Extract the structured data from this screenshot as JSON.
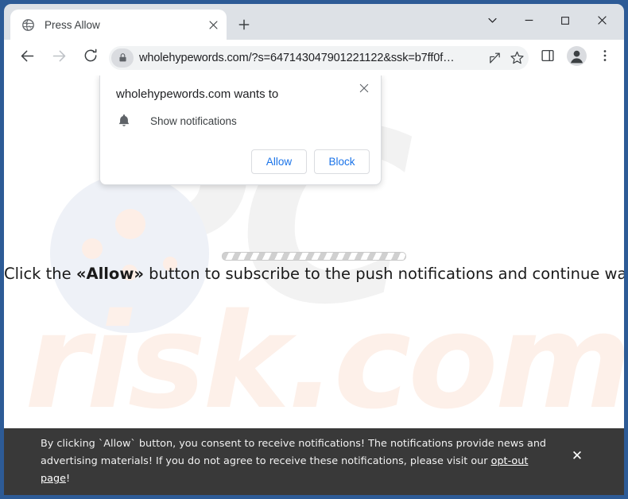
{
  "window": {
    "frame_color": "#2d5b96",
    "controls": [
      {
        "name": "tab-search",
        "icon": "chevron-down-icon"
      },
      {
        "name": "minimize",
        "icon": "minimize-icon"
      },
      {
        "name": "maximize",
        "icon": "maximize-icon"
      },
      {
        "name": "close",
        "icon": "close-icon"
      }
    ]
  },
  "tabstrip": {
    "tab": {
      "title": "Press Allow",
      "favicon": "globe-icon",
      "close_icon": "close-icon"
    },
    "new_tab_icon": "plus-icon"
  },
  "toolbar": {
    "back_icon": "arrow-left-icon",
    "forward_icon": "arrow-right-icon",
    "reload_icon": "reload-icon",
    "omnibox": {
      "lock_icon": "lock-icon",
      "url": "wholehypewords.com/?s=647143047901221122&ssk=b7ff0f…",
      "share_icon": "share-icon",
      "bookmark_icon": "star-icon"
    },
    "side_panel_icon": "side-panel-icon",
    "profile_icon": "profile-avatar-icon",
    "menu_icon": "three-dot-menu-icon"
  },
  "permission_dialog": {
    "title": "wholehypewords.com wants to",
    "close_icon": "close-icon",
    "permission_icon": "bell-icon",
    "permission_label": "Show notifications",
    "allow_label": "Allow",
    "block_label": "Block",
    "accent_color": "#1a73e8"
  },
  "page": {
    "headline_prefix": "Click the ",
    "headline_emphasis": "«Allow»",
    "headline_suffix": " button to subscribe to the push notifications and continue watching",
    "loading_bar": "striped-progress-bar",
    "watermark_primary": "PC",
    "watermark_secondary": "risk.com"
  },
  "consent_banner": {
    "background_color": "#393939",
    "text_before_link": "By clicking `Allow` button, you consent to receive notifications! The notifications provide news and advertising materials! If you do not agree to receive these notifications, please visit our ",
    "link_label": "opt-out page",
    "text_after_link": "!",
    "close_icon": "close-icon"
  }
}
